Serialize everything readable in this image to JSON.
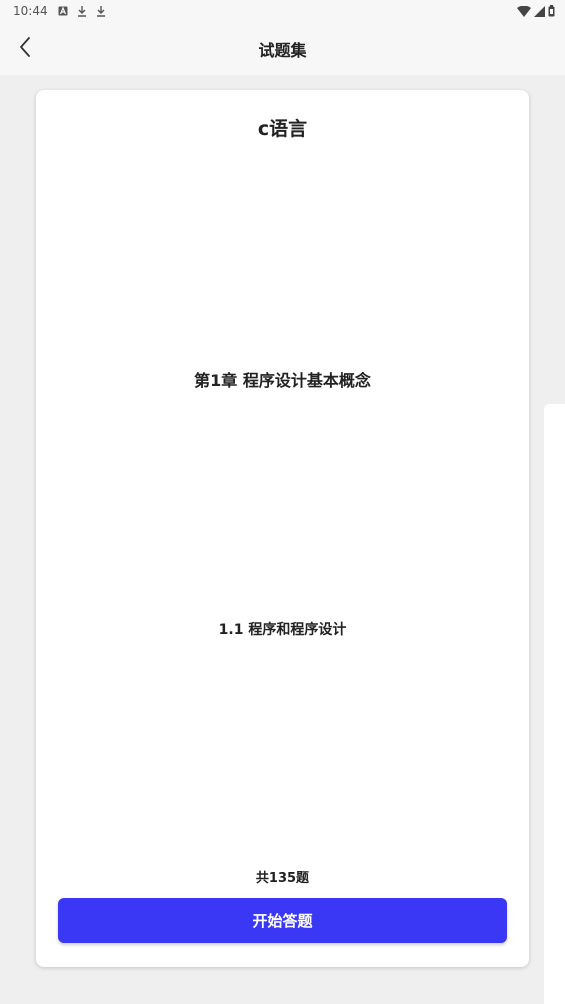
{
  "status_bar": {
    "time": "10:44",
    "left_icons": [
      "accessibility-icon",
      "download-icon",
      "download-icon"
    ],
    "right_icons": [
      "wifi-icon",
      "signal-icon",
      "battery-icon"
    ]
  },
  "app_bar": {
    "title": "试题集",
    "back_icon": "chevron-left-icon"
  },
  "quiz_card": {
    "subject": "c语言",
    "chapter": "第1章 程序设计基本概念",
    "section": "1.1 程序和程序设计",
    "question_count": "共135题",
    "start_button_label": "开始答题",
    "accent_color": "#3a37f5"
  }
}
